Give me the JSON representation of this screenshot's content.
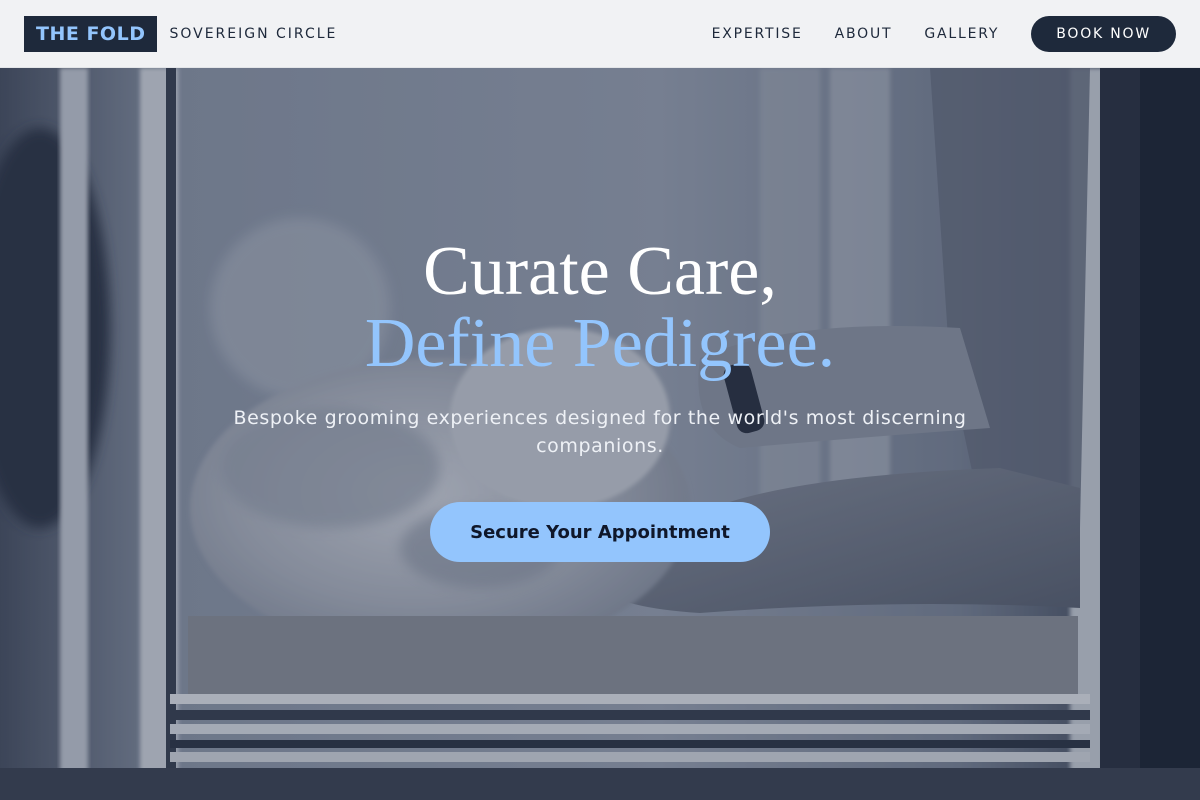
{
  "nav": {
    "logo": "THE FOLD",
    "tagline": "SOVEREIGN CIRCLE",
    "links": [
      "EXPERTISE",
      "ABOUT",
      "GALLERY"
    ],
    "cta_label": "BOOK NOW"
  },
  "hero": {
    "headline_line1": "Curate Care,",
    "headline_line2": "Define Pedigree.",
    "subtitle": "Bespoke grooming experiences designed for the world's most discerning companions.",
    "cta_label": "Secure Your Appointment",
    "background": "grooming-photo-cat-on-table"
  },
  "colors": {
    "navy": "#1e293b",
    "accent_blue": "#93c5fd",
    "nav_bg": "#f1f2f4",
    "white": "#ffffff"
  }
}
